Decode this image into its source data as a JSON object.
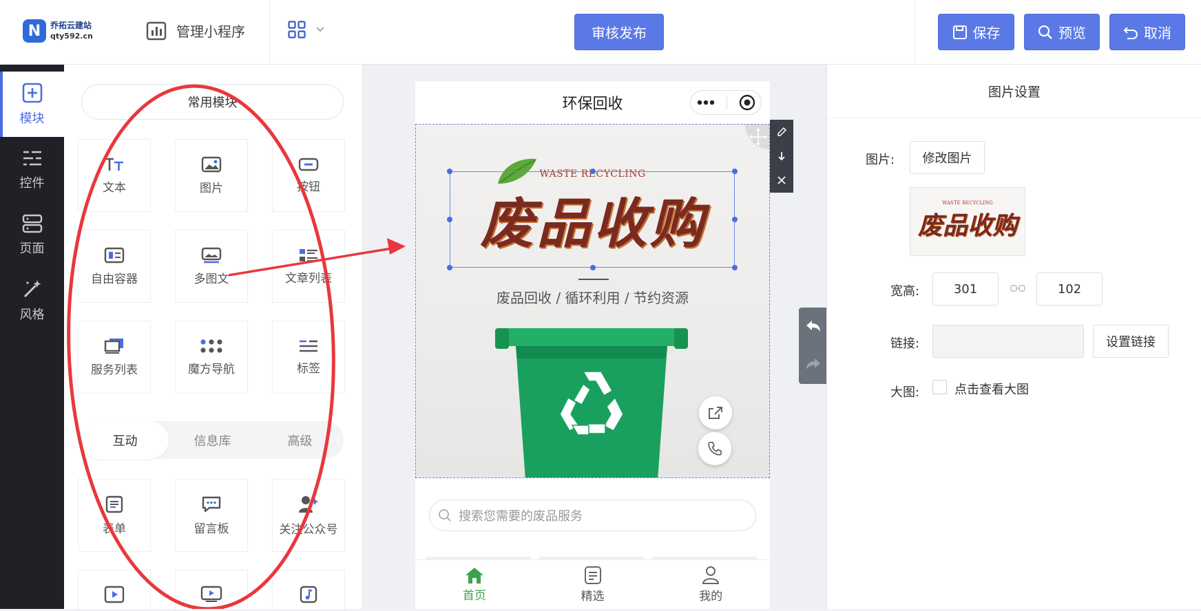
{
  "header": {
    "logo_name": "乔拓云建站",
    "logo_domain": "qty592.cn",
    "logo_letter": "N",
    "manage_label": "管理小程序",
    "publish_label": "审核发布",
    "save_label": "保存",
    "preview_label": "预览",
    "cancel_label": "取消"
  },
  "leftbar": {
    "items": [
      {
        "label": "模块",
        "icon": "plus-square-icon",
        "active": true
      },
      {
        "label": "控件",
        "icon": "sliders-icon",
        "active": false
      },
      {
        "label": "页面",
        "icon": "server-icon",
        "active": false
      },
      {
        "label": "风格",
        "icon": "magic-wand-icon",
        "active": false
      }
    ]
  },
  "modules": {
    "common_title": "常用模块",
    "tiles": [
      {
        "label": "文本",
        "icon": "text-icon"
      },
      {
        "label": "图片",
        "icon": "image-icon"
      },
      {
        "label": "按钮",
        "icon": "button-icon"
      },
      {
        "label": "自由容器",
        "icon": "container-icon"
      },
      {
        "label": "多图文",
        "icon": "multi-image-icon"
      },
      {
        "label": "文章列表",
        "icon": "article-list-icon"
      },
      {
        "label": "服务列表",
        "icon": "service-list-icon"
      },
      {
        "label": "魔方导航",
        "icon": "grid-nav-icon"
      },
      {
        "label": "标签",
        "icon": "tag-icon"
      }
    ],
    "tabs": [
      "互动",
      "信息库",
      "高级"
    ],
    "active_tab": "互动",
    "interactive_tiles": [
      {
        "label": "表单",
        "icon": "form-icon"
      },
      {
        "label": "留言板",
        "icon": "message-board-icon"
      },
      {
        "label": "关注公众号",
        "icon": "follow-account-icon"
      }
    ]
  },
  "phone": {
    "title": "环保回收",
    "banner_subtitle_en": "WASTE RECYCLING",
    "banner_title": "废品收购",
    "banner_tagline": "废品回收  /  循环利用  /  节约资源",
    "search_placeholder": "搜索您需要的废品服务",
    "tabbar": [
      {
        "label": "首页",
        "icon": "home-icon",
        "active": true
      },
      {
        "label": "精选",
        "icon": "featured-icon",
        "active": false
      },
      {
        "label": "我的",
        "icon": "user-icon",
        "active": false
      }
    ]
  },
  "settings": {
    "title": "图片设置",
    "image_label": "图片:",
    "change_image_label": "修改图片",
    "size_label": "宽高:",
    "width": "301",
    "height": "102",
    "link_label": "链接:",
    "link_value": "",
    "set_link_label": "设置链接",
    "bigimage_label": "大图:",
    "bigimage_option": "点击查看大图",
    "bigimage_checked": false
  },
  "colors": {
    "primary": "#5b79e6",
    "sidebar_dark": "#1f2126",
    "active_green": "#3ca34a",
    "bin_green": "#1aa05e",
    "annotation_red": "#e8383d"
  }
}
